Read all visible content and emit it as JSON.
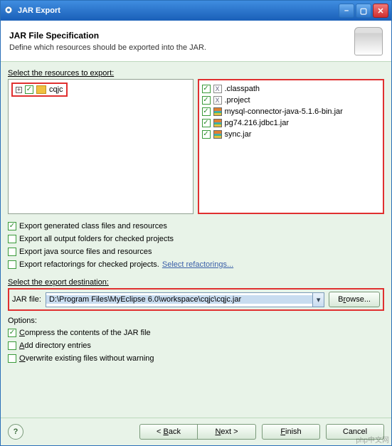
{
  "window": {
    "title": "JAR Export"
  },
  "header": {
    "title": "JAR File Specification",
    "subtitle": "Define which resources should be exported into the JAR."
  },
  "select_label": "Select the resources to export:",
  "left_tree": {
    "item": "cqjc"
  },
  "right_list": [
    {
      "name": ".classpath",
      "icon": "x"
    },
    {
      "name": ".project",
      "icon": "x"
    },
    {
      "name": "mysql-connector-java-5.1.6-bin.jar",
      "icon": "jar"
    },
    {
      "name": "pg74.216.jdbc1.jar",
      "icon": "jar"
    },
    {
      "name": "sync.jar",
      "icon": "jar"
    }
  ],
  "export_opts": {
    "class_files": {
      "checked": true,
      "label": "Export generated class files and resources"
    },
    "output_folders": {
      "checked": false,
      "label": "Export all output folders for checked projects"
    },
    "java_source": {
      "checked": false,
      "label": "Export java source files and resources"
    },
    "refactorings": {
      "checked": false,
      "label": "Export refactorings for checked projects.",
      "link": "Select refactorings..."
    }
  },
  "dest": {
    "label": "Select the export destination:",
    "field_label": "JAR file:",
    "value": "D:\\Program Files\\MyEclipse 6.0\\workspace\\cqjc\\cqjc.jar",
    "browse": "Browse..."
  },
  "options": {
    "label": "Options:",
    "compress": {
      "checked": true,
      "label": "Compress the contents of the JAR file"
    },
    "add_dir": {
      "checked": false,
      "label": "Add directory entries"
    },
    "overwrite": {
      "checked": false,
      "label": "Overwrite existing files without warning"
    }
  },
  "buttons": {
    "back": "< Back",
    "next": "Next >",
    "finish": "Finish",
    "cancel": "Cancel"
  },
  "watermark": "php中文网"
}
